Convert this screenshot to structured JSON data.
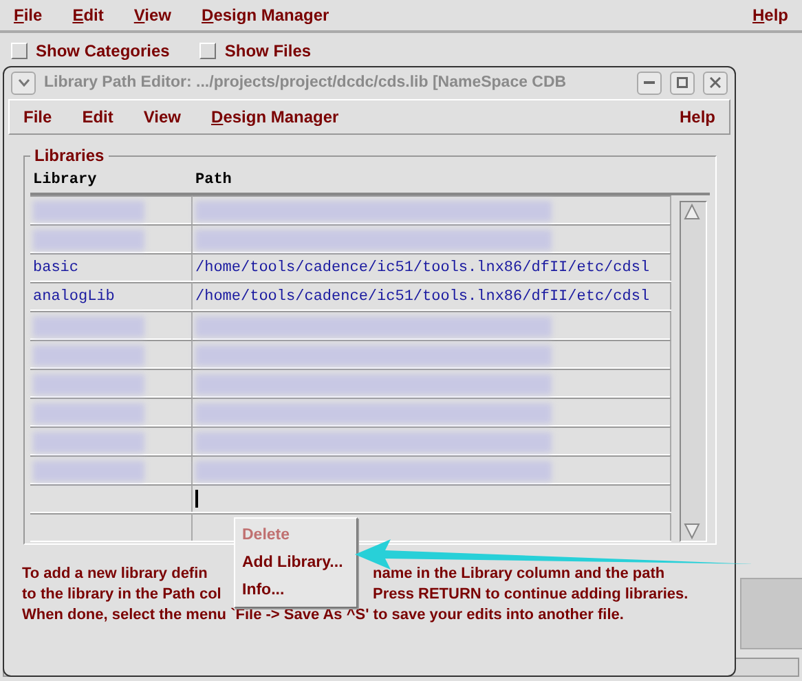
{
  "main_menu": [
    {
      "label": "File",
      "mnemonic": true
    },
    {
      "label": "Edit",
      "mnemonic": true
    },
    {
      "label": "View",
      "mnemonic": true
    },
    {
      "label": "Design Manager",
      "mnemonic": true
    },
    {
      "label": "Help",
      "mnemonic": true
    }
  ],
  "options": [
    {
      "label": "Show Categories",
      "checked": false
    },
    {
      "label": "Show Files",
      "checked": false
    }
  ],
  "dialog": {
    "title": "Library Path Editor: .../projects/project/dcdc/cds.lib [NameSpace CDB",
    "menu": [
      {
        "label": "File",
        "mnemonic": false
      },
      {
        "label": "Edit",
        "mnemonic": false
      },
      {
        "label": "View",
        "mnemonic": false
      },
      {
        "label": "Design Manager",
        "mnemonic": true
      },
      {
        "label": "Help",
        "mnemonic": false
      }
    ],
    "group_title": "Libraries",
    "table": {
      "columns": [
        "Library",
        "Path"
      ],
      "rows": [
        {
          "kind": "blurred"
        },
        {
          "kind": "blurred"
        },
        {
          "kind": "text",
          "cells": [
            "basic",
            "/home/tools/cadence/ic51/tools.lnx86/dfII/etc/cdsl"
          ]
        },
        {
          "kind": "text",
          "cells": [
            "analogLib",
            "/home/tools/cadence/ic51/tools.lnx86/dfII/etc/cdsl"
          ]
        },
        {
          "kind": "blurred"
        },
        {
          "kind": "blurred"
        },
        {
          "kind": "blurred"
        },
        {
          "kind": "blurred"
        },
        {
          "kind": "blurred"
        },
        {
          "kind": "blurred"
        },
        {
          "kind": "editing"
        },
        {
          "kind": "empty"
        }
      ]
    },
    "help_lines": [
      [
        "To add a new library defin",
        "name in the Library column and the path"
      ],
      [
        "to the library in the Path col",
        "Press RETURN to continue adding libraries."
      ],
      [
        "When done, select the menu `File -> Save As  ^S' to save your edits into another file."
      ]
    ],
    "context_menu": [
      {
        "label": "Delete",
        "disabled": true
      },
      {
        "label": "Add Library...",
        "disabled": false
      },
      {
        "label": "Info...",
        "disabled": false
      }
    ]
  }
}
